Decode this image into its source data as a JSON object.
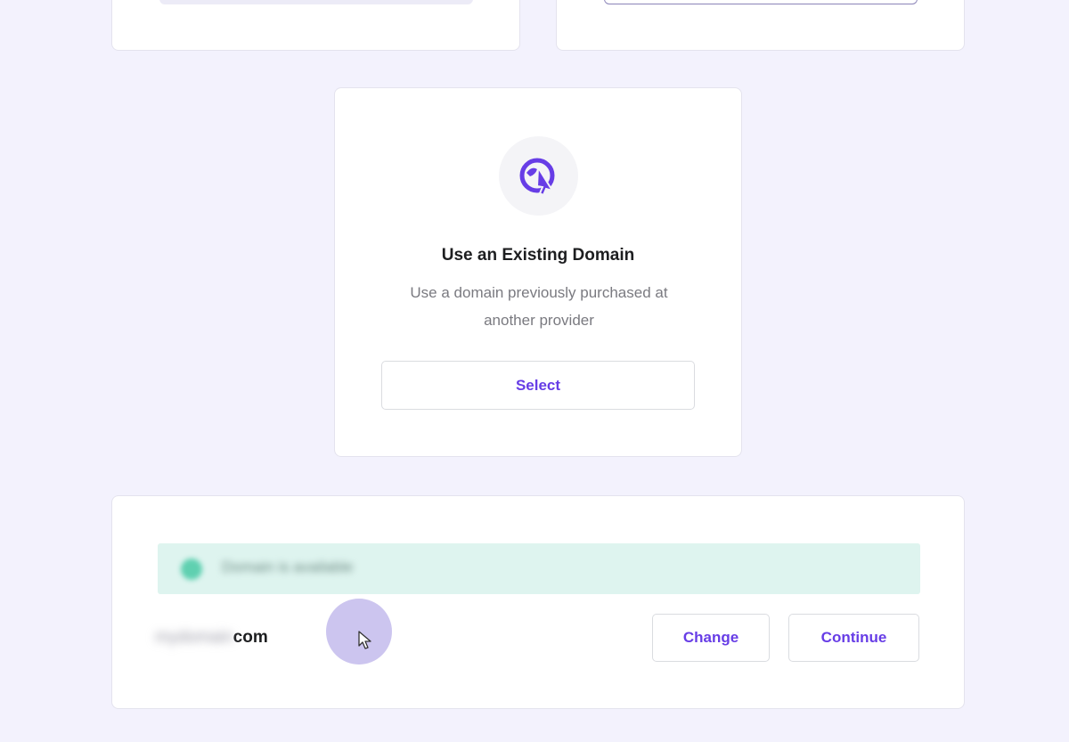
{
  "existing_domain": {
    "title": "Use an Existing Domain",
    "description": "Use a domain previously purchased at another provider",
    "select_label": "Select",
    "icon": "globe-cursor-icon"
  },
  "domain_summary": {
    "status_text": "Domain is available",
    "domain_name_blurred": "mydomain",
    "domain_suffix": "com",
    "change_label": "Change",
    "continue_label": "Continue"
  },
  "colors": {
    "accent": "#673de6",
    "background": "#f3f2fd",
    "status_bg": "#def4ef",
    "status_dot": "#5fd0b0"
  }
}
